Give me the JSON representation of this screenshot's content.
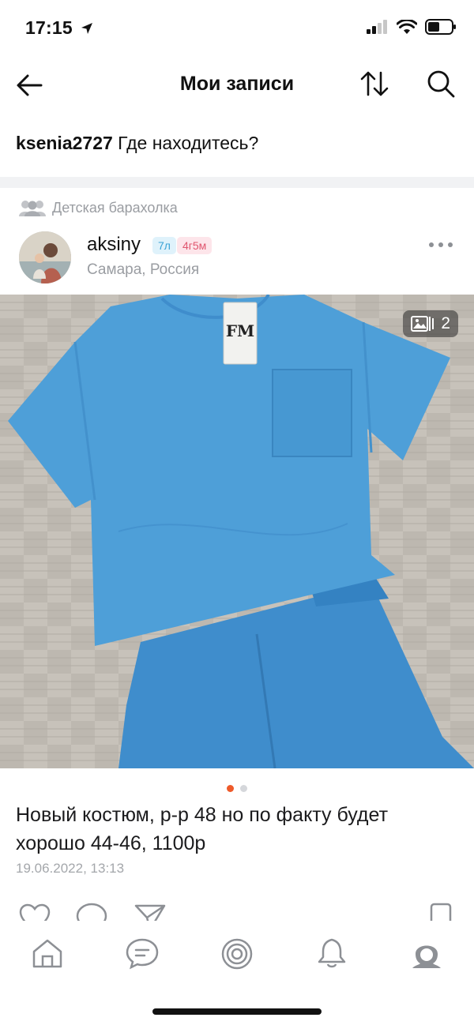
{
  "status": {
    "time": "17:15"
  },
  "header": {
    "title": "Мои записи"
  },
  "query": {
    "user": "ksenia2727",
    "text": "Где находитесь?"
  },
  "post": {
    "community": "Детская барахолка",
    "author": {
      "name": "aksiny",
      "badge_age": "7л",
      "badge_kids": "4г5м",
      "location": "Самара, Россия"
    },
    "photo_count": "2",
    "text": "Новый костюм, р-р 48 но по факту будет хорошо 44-46, 1100р",
    "date": "19.06.2022, 13:13"
  },
  "tag_label": "FM",
  "colors": {
    "accent": "#ee5a2a",
    "garment": "#4e9fd8",
    "muted": "#9a9da2"
  },
  "icons": [
    "back-arrow-icon",
    "sort-icon",
    "search-icon",
    "community-icon",
    "more-icon",
    "gallery-icon",
    "like-icon",
    "comment-icon",
    "share-icon",
    "bookmark-icon",
    "home-icon",
    "chat-icon",
    "target-icon",
    "bell-icon",
    "profile-icon"
  ]
}
